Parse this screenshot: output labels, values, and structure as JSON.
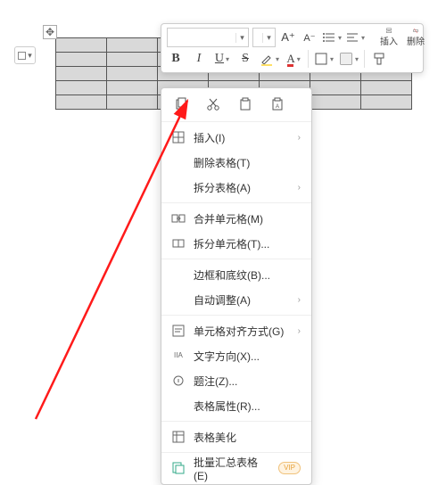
{
  "left_chip": {
    "label": ""
  },
  "table": {
    "rows": 5,
    "cols": 7
  },
  "toolbar": {
    "font_name": "",
    "font_size": "",
    "Aplus": "A⁺",
    "Aminus": "A⁻",
    "bold": "B",
    "italic": "I",
    "underline": "U",
    "strike": "S",
    "font_color": "A",
    "insert_label": "插入",
    "delete_label": "删除"
  },
  "ctx_top": {
    "copy": "copy",
    "cut": "cut",
    "paste": "paste",
    "paste_special": "paste-special"
  },
  "menu": {
    "insert": "插入(I)",
    "delete_table": "删除表格(T)",
    "split_table": "拆分表格(A)",
    "merge_cells": "合并单元格(M)",
    "split_cells": "拆分单元格(T)...",
    "borders_shading": "边框和底纹(B)...",
    "autofit": "自动调整(A)",
    "cell_align": "单元格对齐方式(G)",
    "text_direction": "文字方向(X)...",
    "caption": "题注(Z)...",
    "table_props": "表格属性(R)...",
    "table_beautify": "表格美化",
    "batch_summary": "批量汇总表格(E)",
    "vip": "VIP"
  },
  "colors": {
    "highlight_swatch": "#ffe066",
    "font_color_swatch": "#d33",
    "arrow": "#ff1a1a"
  }
}
